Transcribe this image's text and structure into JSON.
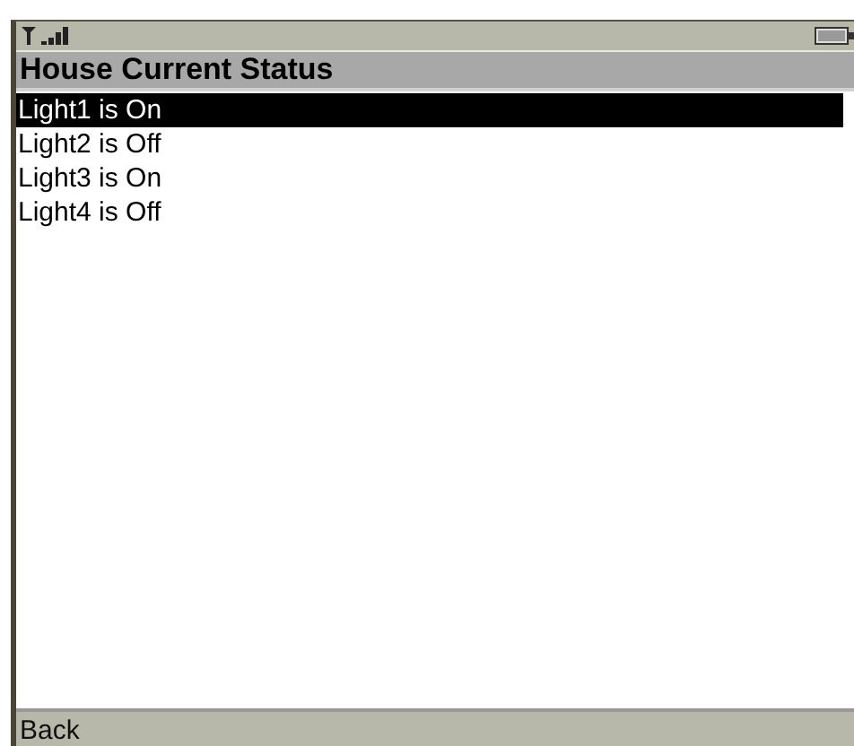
{
  "title": "House Current Status",
  "items": [
    {
      "label": "Light1 is On",
      "selected": true
    },
    {
      "label": "Light2 is Off",
      "selected": false
    },
    {
      "label": "Light3 is On",
      "selected": false
    },
    {
      "label": "Light4 is Off",
      "selected": false
    }
  ],
  "soft_key": "Back"
}
